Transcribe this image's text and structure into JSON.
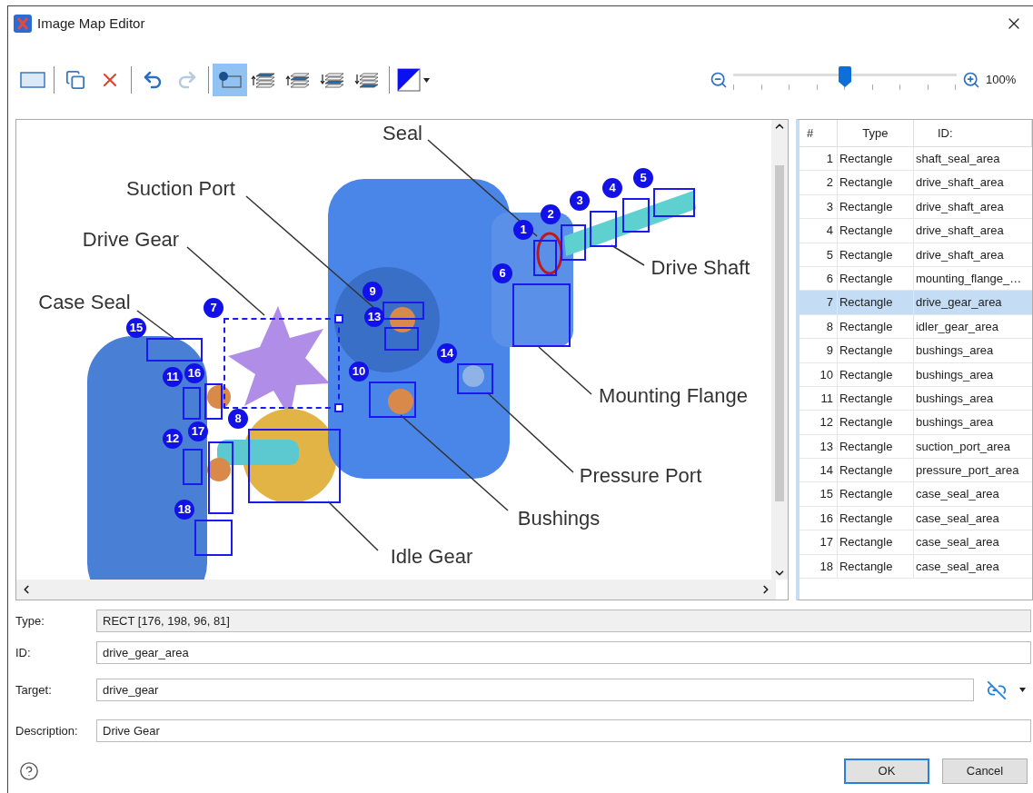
{
  "window": {
    "title": "Image Map Editor"
  },
  "toolbar": {
    "groups": [
      [
        {
          "kind": "rectangle",
          "selected": false,
          "disabled": false
        }
      ],
      [
        {
          "kind": "duplicate",
          "selected": false,
          "disabled": false
        },
        {
          "kind": "delete",
          "selected": false,
          "disabled": false
        }
      ],
      [
        {
          "kind": "undo",
          "selected": false,
          "disabled": false
        },
        {
          "kind": "redo",
          "selected": false,
          "disabled": true
        }
      ],
      [
        {
          "kind": "numbers",
          "selected": true,
          "disabled": false
        },
        {
          "kind": "to-front",
          "selected": false,
          "disabled": false
        },
        {
          "kind": "forward",
          "selected": false,
          "disabled": false
        },
        {
          "kind": "backward",
          "selected": false,
          "disabled": false
        },
        {
          "kind": "to-back",
          "selected": false,
          "disabled": false
        }
      ],
      [
        {
          "kind": "color",
          "selected": false,
          "disabled": false
        }
      ]
    ]
  },
  "zoom": {
    "level": 0.5,
    "reading": "100%"
  },
  "canvas": {
    "callouts": [
      {
        "text": "Seal"
      },
      {
        "text": "Suction Port"
      },
      {
        "text": "Drive Gear"
      },
      {
        "text": "Case Seal"
      },
      {
        "text": "Drive Shaft"
      },
      {
        "text": "Mounting Flange"
      },
      {
        "text": "Pressure Port"
      },
      {
        "text": "Bushings"
      },
      {
        "text": "Idle Gear"
      }
    ],
    "areas": [
      {
        "number": "1",
        "selected": false
      },
      {
        "number": "2",
        "selected": false
      },
      {
        "number": "3",
        "selected": false
      },
      {
        "number": "4",
        "selected": false
      },
      {
        "number": "5",
        "selected": false
      },
      {
        "number": "6",
        "selected": false
      },
      {
        "number": "7",
        "selected": true
      },
      {
        "number": "8",
        "selected": false
      },
      {
        "number": "9",
        "selected": false
      },
      {
        "number": "10",
        "selected": false
      },
      {
        "number": "11",
        "selected": false
      },
      {
        "number": "12",
        "selected": false
      },
      {
        "number": "13",
        "selected": false
      },
      {
        "number": "14",
        "selected": false
      },
      {
        "number": "15",
        "selected": false
      },
      {
        "number": "16",
        "selected": false
      },
      {
        "number": "17",
        "selected": false
      },
      {
        "number": "18",
        "selected": false
      }
    ]
  },
  "table": {
    "columns": [
      "#",
      "Type",
      "ID:"
    ],
    "rows": [
      {
        "number": "1",
        "type": "Rectangle",
        "id": "shaft_seal_area",
        "selected": false
      },
      {
        "number": "2",
        "type": "Rectangle",
        "id": "drive_shaft_area",
        "selected": false
      },
      {
        "number": "3",
        "type": "Rectangle",
        "id": "drive_shaft_area",
        "selected": false
      },
      {
        "number": "4",
        "type": "Rectangle",
        "id": "drive_shaft_area",
        "selected": false
      },
      {
        "number": "5",
        "type": "Rectangle",
        "id": "drive_shaft_area",
        "selected": false
      },
      {
        "number": "6",
        "type": "Rectangle",
        "id": "mounting_flange_…",
        "selected": false
      },
      {
        "number": "7",
        "type": "Rectangle",
        "id": "drive_gear_area",
        "selected": true
      },
      {
        "number": "8",
        "type": "Rectangle",
        "id": "idler_gear_area",
        "selected": false
      },
      {
        "number": "9",
        "type": "Rectangle",
        "id": "bushings_area",
        "selected": false
      },
      {
        "number": "10",
        "type": "Rectangle",
        "id": "bushings_area",
        "selected": false
      },
      {
        "number": "11",
        "type": "Rectangle",
        "id": "bushings_area",
        "selected": false
      },
      {
        "number": "12",
        "type": "Rectangle",
        "id": "bushings_area",
        "selected": false
      },
      {
        "number": "13",
        "type": "Rectangle",
        "id": "suction_port_area",
        "selected": false
      },
      {
        "number": "14",
        "type": "Rectangle",
        "id": "pressure_port_area",
        "selected": false
      },
      {
        "number": "15",
        "type": "Rectangle",
        "id": "case_seal_area",
        "selected": false
      },
      {
        "number": "16",
        "type": "Rectangle",
        "id": "case_seal_area",
        "selected": false
      },
      {
        "number": "17",
        "type": "Rectangle",
        "id": "case_seal_area",
        "selected": false
      },
      {
        "number": "18",
        "type": "Rectangle",
        "id": "case_seal_area",
        "selected": false
      }
    ]
  },
  "fields": [
    {
      "label": "Type:",
      "value": "RECT [176, 198, 96, 81]",
      "readonly": true,
      "kind": "plain"
    },
    {
      "label": "ID:",
      "value": "drive_gear_area",
      "readonly": false,
      "kind": "plain"
    },
    {
      "label": "Target:",
      "value": "drive_gear",
      "readonly": false,
      "kind": "link"
    },
    {
      "label": "Description:",
      "value": "Drive Gear",
      "readonly": false,
      "kind": "plain"
    }
  ],
  "buttons": [
    {
      "label": "OK",
      "default": true
    },
    {
      "label": "Cancel",
      "default": false
    }
  ]
}
